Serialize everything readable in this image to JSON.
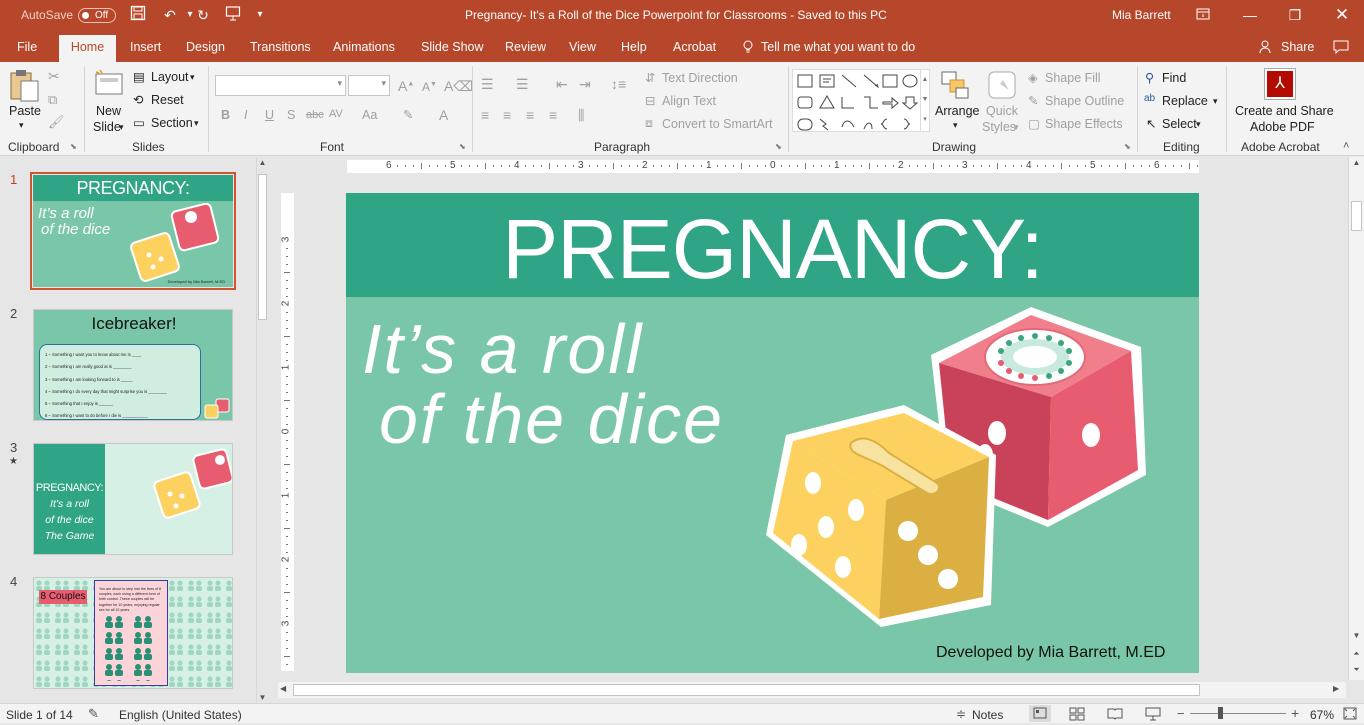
{
  "titlebar": {
    "autosave_label": "AutoSave",
    "autosave_state": "Off",
    "doc_title": "Pregnancy- It's a Roll of the Dice Powerpoint for Classrooms  -  Saved to this PC",
    "user": "Mia Barrett"
  },
  "tabs": [
    "File",
    "Home",
    "Insert",
    "Design",
    "Transitions",
    "Animations",
    "Slide Show",
    "Review",
    "View",
    "Help",
    "Acrobat"
  ],
  "tell_me": "Tell me what you want to do",
  "share": "Share",
  "ribbon": {
    "clipboard": {
      "paste": "Paste",
      "label": "Clipboard"
    },
    "slides": {
      "new": "New",
      "slide": "Slide",
      "layout": "Layout",
      "reset": "Reset",
      "section": "Section",
      "label": "Slides"
    },
    "font": {
      "label": "Font",
      "bold": "B",
      "italic": "I",
      "underline": "U",
      "shadow": "S",
      "strike": "abc",
      "spacing": "AV",
      "case": "Aa"
    },
    "paragraph": {
      "text_direction": "Text Direction",
      "align_text": "Align Text",
      "smartart": "Convert to SmartArt",
      "label": "Paragraph"
    },
    "drawing": {
      "arrange": "Arrange",
      "quick": "Quick",
      "styles": "Styles",
      "shape_fill": "Shape Fill",
      "shape_outline": "Shape Outline",
      "shape_effects": "Shape Effects",
      "label": "Drawing"
    },
    "editing": {
      "find": "Find",
      "replace": "Replace",
      "select": "Select",
      "label": "Editing"
    },
    "acrobat": {
      "line1": "Create and Share",
      "line2": "Adobe PDF",
      "label": "Adobe Acrobat"
    }
  },
  "ruler": {
    "h_ticks": [
      "6",
      "5",
      "4",
      "3",
      "2",
      "1",
      "0",
      "1",
      "2",
      "3",
      "4",
      "5",
      "6"
    ],
    "v_ticks": [
      "3",
      "2",
      "1",
      "0",
      "1",
      "2",
      "3"
    ]
  },
  "thumbnails": [
    {
      "num": "1",
      "title": "PREGNANCY:",
      "sub1": "It’s a roll",
      "sub2": "of the dice",
      "credit": "Developed by Mia Barrett, M.ED"
    },
    {
      "num": "2",
      "title": "Icebreaker!",
      "items": [
        "1 – Something I want you to know about me is ____",
        "2 – Something I am really good at is ________",
        "3 – Something I am looking forward to is _____",
        "4 – Something I do every day that might surprise you is ________",
        "5 – Something that I enjoy is ______",
        "6 – Something I want to do before I die is ___________"
      ]
    },
    {
      "num": "3",
      "star": "★",
      "line1": "PREGNANCY:",
      "line2": "It’s a roll",
      "line3": "of the dice",
      "line4": "The Game"
    },
    {
      "num": "4",
      "badge": "8 Couples",
      "text": "You are about to step into the lives of 8 couples, each using a different form of birth control. These couples will be together for 10 years, enjoying regular sex for all 10 years."
    }
  ],
  "slide": {
    "title": "PREGNANCY:",
    "sub1": "It’s a roll",
    "sub2": "of the dice",
    "credit": "Developed by Mia Barrett, M.ED",
    "colors": {
      "header": "#2fa585",
      "body": "#79c7a8",
      "yellow": "#fdd15f",
      "red": "#e85c6f"
    }
  },
  "status": {
    "slide_of": "Slide 1 of 14",
    "language": "English (United States)",
    "notes": "Notes",
    "zoom": "67%"
  }
}
